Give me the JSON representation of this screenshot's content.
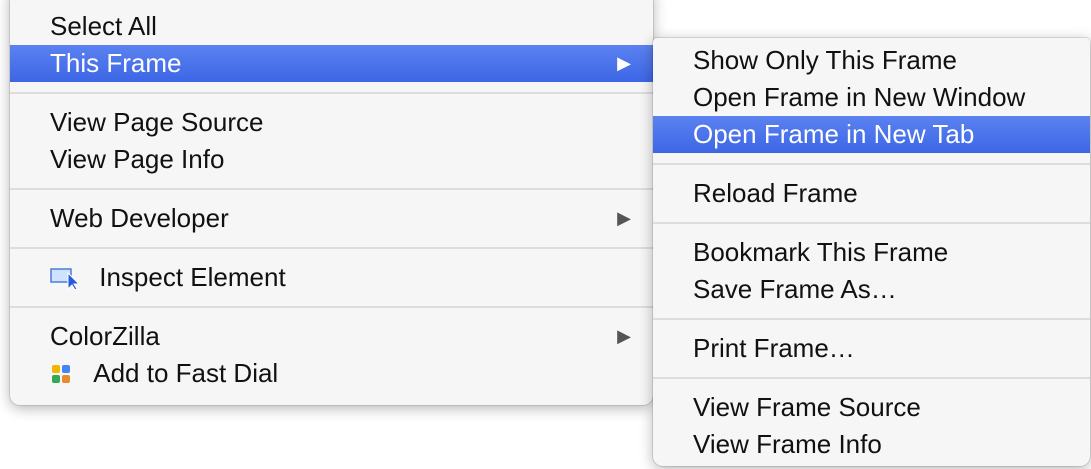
{
  "main_menu": {
    "items": [
      {
        "label": "Select All"
      },
      {
        "label": "This Frame",
        "arrow": "▶"
      },
      {
        "label": "View Page Source"
      },
      {
        "label": "View Page Info"
      },
      {
        "label": "Web Developer",
        "arrow": "▶"
      },
      {
        "label": "Inspect Element",
        "icon": "inspect-element-icon"
      },
      {
        "label": "ColorZilla",
        "arrow": "▶"
      },
      {
        "label": "Add to Fast Dial",
        "icon": "fast-dial-icon"
      }
    ]
  },
  "sub_menu": {
    "items": [
      {
        "label": "Show Only This Frame"
      },
      {
        "label": "Open Frame in New Window"
      },
      {
        "label": "Open Frame in New Tab"
      },
      {
        "label": "Reload Frame"
      },
      {
        "label": "Bookmark This Frame"
      },
      {
        "label": "Save Frame As…"
      },
      {
        "label": "Print Frame…"
      },
      {
        "label": "View Frame Source"
      },
      {
        "label": "View Frame Info"
      }
    ]
  },
  "colors": {
    "highlight": "#3d66e6",
    "menu_background": "#f6f6f6",
    "separator": "#dddddd"
  }
}
